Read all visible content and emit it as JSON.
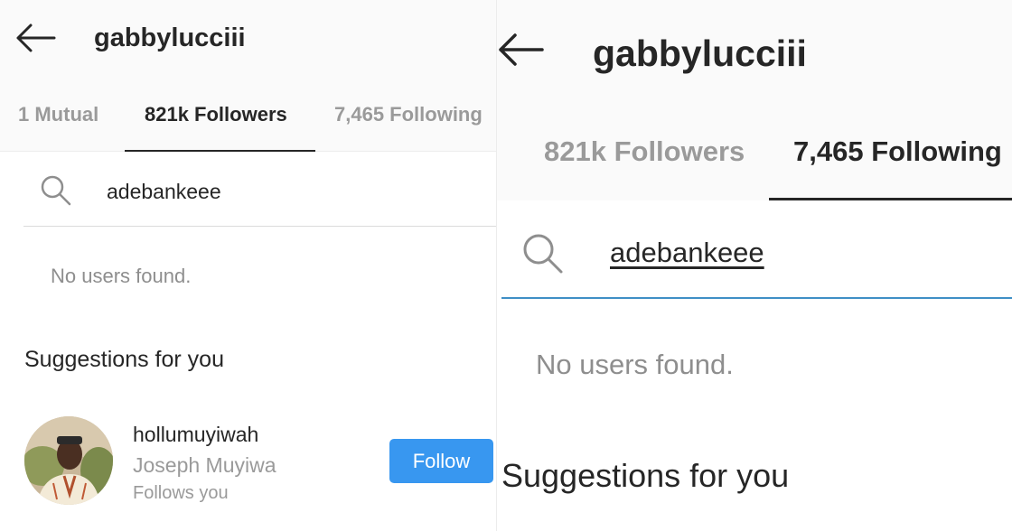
{
  "left_panel": {
    "header": {
      "title": "gabbylucciii"
    },
    "tabs": [
      {
        "label": "1 Mutual"
      },
      {
        "label": "821k Followers"
      },
      {
        "label": "7,465 Following"
      }
    ],
    "search": {
      "value": "adebankeee"
    },
    "empty_text": "No users found.",
    "section_heading": "Suggestions for you",
    "suggestion": {
      "username": "hollumuyiwah",
      "full_name": "Joseph Muyiwa",
      "note": "Follows you",
      "button_label": "Follow"
    }
  },
  "right_panel": {
    "header": {
      "title": "gabbylucciii"
    },
    "tabs": [
      {
        "label": "821k Followers"
      },
      {
        "label": "7,465 Following"
      }
    ],
    "search": {
      "value": "adebankeee"
    },
    "empty_text": "No users found.",
    "section_heading": "Suggestions for you"
  },
  "colors": {
    "follow_button": "#3897f0",
    "search_focus_line": "#3f8fc6",
    "muted_text": "#8e8e8e",
    "primary_text": "#262626"
  },
  "icons": [
    "back-arrow-icon",
    "search-icon"
  ]
}
